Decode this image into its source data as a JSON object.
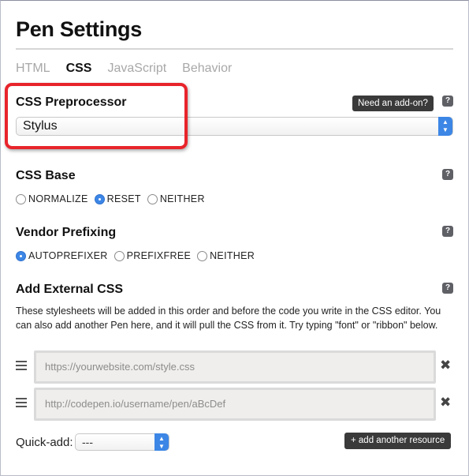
{
  "title": "Pen Settings",
  "tabs": [
    {
      "label": "HTML",
      "active": false
    },
    {
      "label": "CSS",
      "active": true
    },
    {
      "label": "JavaScript",
      "active": false
    },
    {
      "label": "Behavior",
      "active": false
    }
  ],
  "preprocessor": {
    "heading": "CSS Preprocessor",
    "addon_button": "Need an add-on?",
    "help": "?",
    "selected": "Stylus"
  },
  "css_base": {
    "heading": "CSS Base",
    "help": "?",
    "options": [
      {
        "label": "NORMALIZE",
        "checked": false
      },
      {
        "label": "RESET",
        "checked": true
      },
      {
        "label": "NEITHER",
        "checked": false
      }
    ]
  },
  "vendor": {
    "heading": "Vendor Prefixing",
    "help": "?",
    "options": [
      {
        "label": "AUTOPREFIXER",
        "checked": true
      },
      {
        "label": "PREFIXFREE",
        "checked": false
      },
      {
        "label": "NEITHER",
        "checked": false
      }
    ]
  },
  "external": {
    "heading": "Add External CSS",
    "help": "?",
    "description": "These stylesheets will be added in this order and before the code you write in the CSS editor. You can also add another Pen here, and it will pull the CSS from it. Try typing \"font\" or \"ribbon\" below.",
    "resources": [
      {
        "placeholder": "https://yourwebsite.com/style.css",
        "close": "✖"
      },
      {
        "placeholder": "http://codepen.io/username/pen/aBcDef",
        "close": "✖"
      }
    ],
    "quick_add_label": "Quick-add:",
    "quick_add_value": "---",
    "add_resource_button": "+ add another resource"
  },
  "colors": {
    "highlight": "#e8242b",
    "accent": "#3c86e6"
  }
}
